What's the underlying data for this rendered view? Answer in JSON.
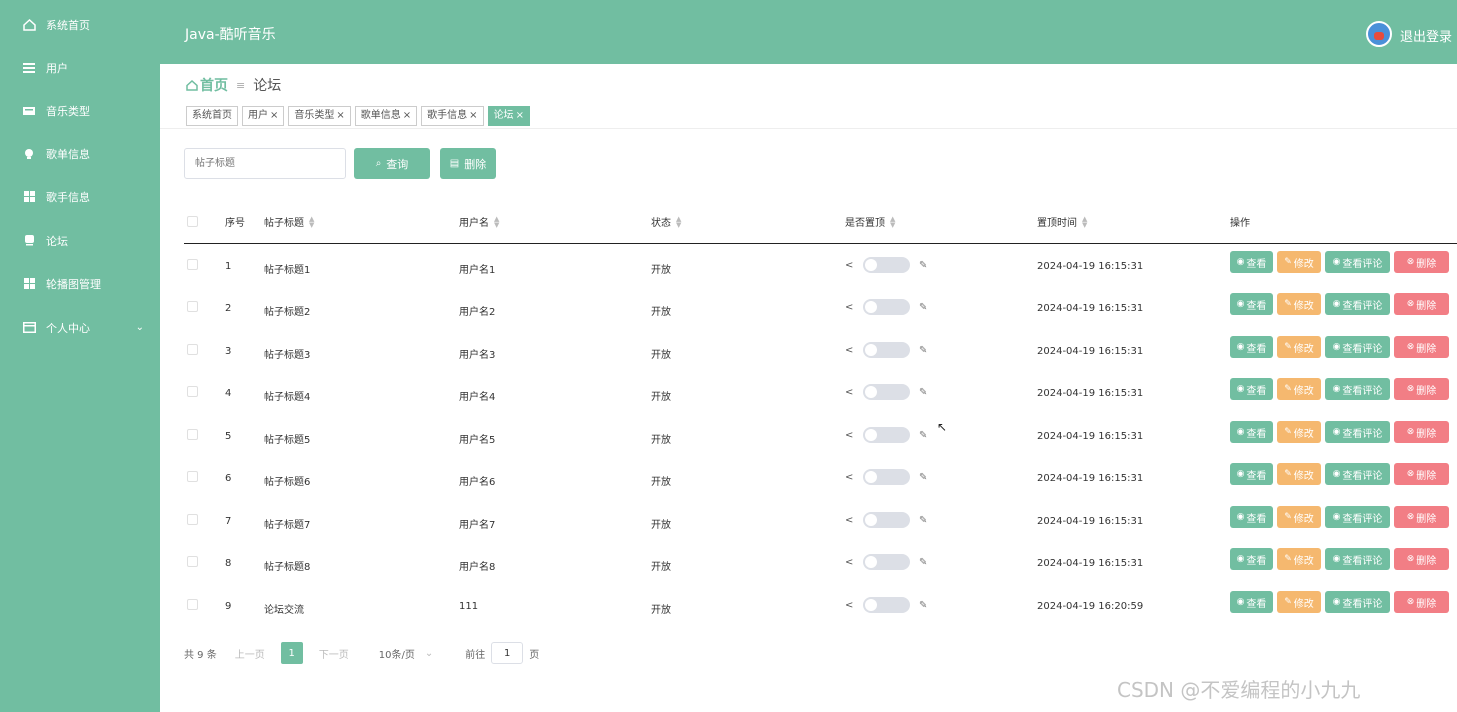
{
  "sidebar": {
    "items": [
      {
        "label": "系统首页",
        "icon": "home-icon"
      },
      {
        "label": "用户",
        "icon": "list-icon"
      },
      {
        "label": "音乐类型",
        "icon": "category-icon"
      },
      {
        "label": "歌单信息",
        "icon": "bulb-icon"
      },
      {
        "label": "歌手信息",
        "icon": "grid-icon"
      },
      {
        "label": "论坛",
        "icon": "chat-icon"
      },
      {
        "label": "轮播图管理",
        "icon": "grid-icon"
      },
      {
        "label": "个人中心",
        "icon": "card-icon",
        "arrow": "⌄"
      }
    ]
  },
  "header": {
    "title": "Java-酷听音乐",
    "logout": "退出登录"
  },
  "breadcrumb": {
    "home": "首页",
    "separator": "≡",
    "current": "论坛"
  },
  "tabs": [
    {
      "label": "系统首页",
      "closable": false
    },
    {
      "label": "用户",
      "closable": true
    },
    {
      "label": "音乐类型",
      "closable": true
    },
    {
      "label": "歌单信息",
      "closable": true
    },
    {
      "label": "歌手信息",
      "closable": true
    },
    {
      "label": "论坛",
      "closable": true,
      "active": true
    }
  ],
  "toolbar": {
    "search_placeholder": "帖子标题",
    "query_label": "查询",
    "delete_label": "删除"
  },
  "table": {
    "columns": [
      "序号",
      "帖子标题",
      "用户名",
      "状态",
      "是否置顶",
      "置顶时间",
      "操作"
    ],
    "rows": [
      {
        "no": "1",
        "title": "帖子标题1",
        "user": "用户名1",
        "status": "开放",
        "pinned": false,
        "time": "2024-04-19 16:15:31"
      },
      {
        "no": "2",
        "title": "帖子标题2",
        "user": "用户名2",
        "status": "开放",
        "pinned": false,
        "time": "2024-04-19 16:15:31"
      },
      {
        "no": "3",
        "title": "帖子标题3",
        "user": "用户名3",
        "status": "开放",
        "pinned": false,
        "time": "2024-04-19 16:15:31"
      },
      {
        "no": "4",
        "title": "帖子标题4",
        "user": "用户名4",
        "status": "开放",
        "pinned": false,
        "time": "2024-04-19 16:15:31"
      },
      {
        "no": "5",
        "title": "帖子标题5",
        "user": "用户名5",
        "status": "开放",
        "pinned": false,
        "time": "2024-04-19 16:15:31"
      },
      {
        "no": "6",
        "title": "帖子标题6",
        "user": "用户名6",
        "status": "开放",
        "pinned": false,
        "time": "2024-04-19 16:15:31"
      },
      {
        "no": "7",
        "title": "帖子标题7",
        "user": "用户名7",
        "status": "开放",
        "pinned": false,
        "time": "2024-04-19 16:15:31"
      },
      {
        "no": "8",
        "title": "帖子标题8",
        "user": "用户名8",
        "status": "开放",
        "pinned": false,
        "time": "2024-04-19 16:15:31"
      },
      {
        "no": "9",
        "title": "论坛交流",
        "user": "111",
        "status": "开放",
        "pinned": false,
        "time": "2024-04-19 16:20:59"
      }
    ],
    "actions": {
      "view": "查看",
      "edit": "修改",
      "comments": "查看评论",
      "delete": "删除"
    }
  },
  "pagination": {
    "total": "共 9 条",
    "prev": "上一页",
    "current_page": "1",
    "next": "下一页",
    "page_size": "10条/页",
    "jump_prefix": "前往",
    "jump_value": "1",
    "jump_suffix": "页"
  },
  "watermark": "CSDN @不爱编程的小九九",
  "colors": {
    "primary": "#71bea1",
    "edit": "#f5b86f",
    "delete": "#f27e85"
  }
}
